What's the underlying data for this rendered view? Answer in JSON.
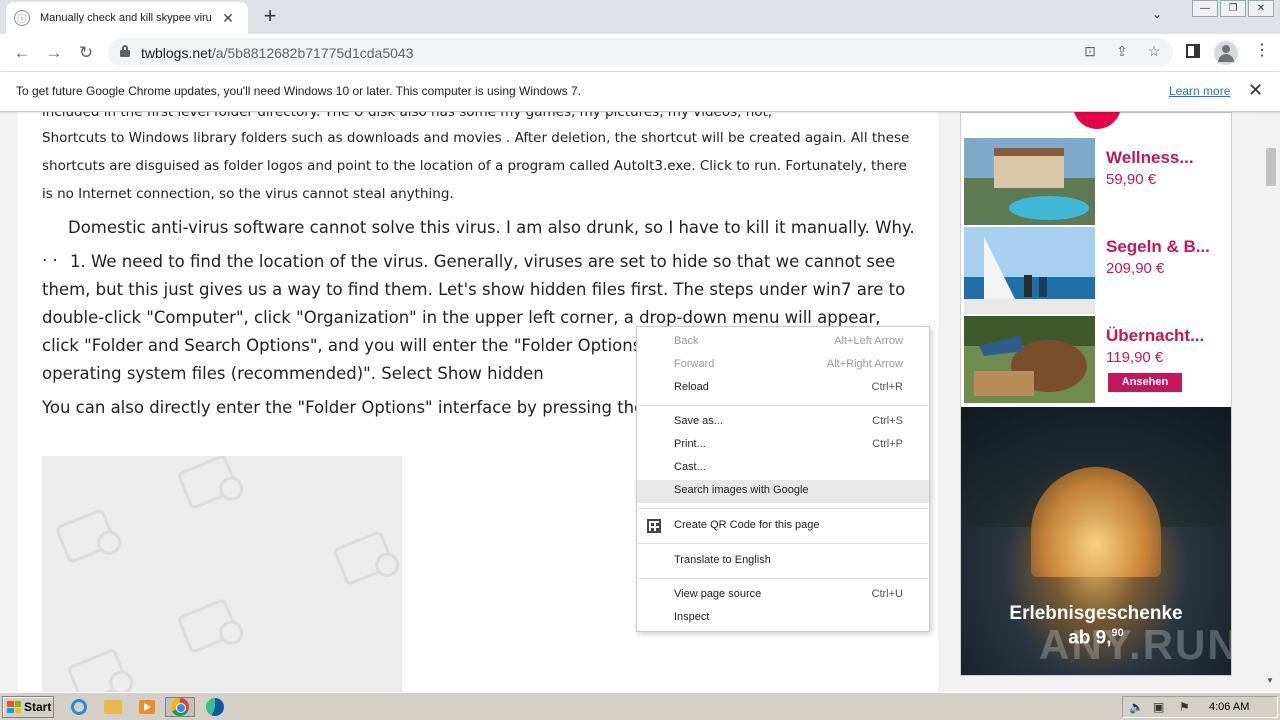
{
  "browser": {
    "tab": {
      "title": "Manually check and kill skypee virus",
      "favicon": "ⓘ",
      "close": "✕"
    },
    "new_tab": "+",
    "tab_search": "⌄",
    "window_controls": {
      "minimize": "—",
      "restore": "❐",
      "close": "✕"
    },
    "nav": {
      "back": "←",
      "forward": "→",
      "reload": "↻"
    },
    "url": {
      "host": "twblogs.net",
      "path": "/a/5b8812682b71775d1cda5043"
    },
    "omnibox_icons": {
      "translate": "⊡",
      "share": "⇪",
      "bookmark": "☆"
    },
    "menu": "⋮"
  },
  "infobar": {
    "message": "To get future Google Chrome updates, you'll need Windows 10 or later. This computer is using Windows 7.",
    "link": "Learn more",
    "close": "✕"
  },
  "article": {
    "p_cut": "included in the first level folder directory. The U disk also has some my games, my pictures, my videos, not,",
    "p1": "Shortcuts to Windows library folders such as downloads and movies . After deletion, the shortcut will be created again. All these shortcuts are disguised as folder logos and point to the location of a program called AutoIt3.exe. Click to run. Fortunately, there is no Internet connection, so the virus cannot steal anything.",
    "p2": "Domestic anti-virus software cannot solve this virus. I am also drunk, so I have to kill it manually. Why. . .",
    "p3": "1. We need to find the location of the virus. Generally, viruses are set to hide so that we cannot see them, but this just gives us a way to find them. Let's show hidden files first. The steps under win7 are to double-click \"Computer\", click \"Organization\" in the upper left corner, a drop-down menu will appear, click \"Folder and Search Options\", and you will enter the \"Folder Options\" interface. \"Hide protected operating system files (recommended)\". Select Show hidden",
    "p4": "You can also directly enter the \"Folder Options\" interface by pressing the entering control folders."
  },
  "ads": {
    "items": [
      {
        "title": "Wellness...",
        "price": "59,90 €"
      },
      {
        "title": "Segeln & B...",
        "price": "209,90 €"
      },
      {
        "title": "Übernacht...",
        "price": "119,90 €",
        "button": "Ansehen"
      }
    ],
    "banner": {
      "line1": "Erlebnisgeschenke",
      "line2": "ab 9,",
      "line2_sup": "90"
    },
    "watermark": "ANY.RUN"
  },
  "context_menu": {
    "items": [
      {
        "label": "Back",
        "shortcut": "Alt+Left Arrow",
        "disabled": true
      },
      {
        "label": "Forward",
        "shortcut": "Alt+Right Arrow",
        "disabled": true
      },
      {
        "label": "Reload",
        "shortcut": "Ctrl+R"
      },
      {
        "label": "Save as...",
        "shortcut": "Ctrl+S"
      },
      {
        "label": "Print...",
        "shortcut": "Ctrl+P"
      },
      {
        "label": "Cast..."
      },
      {
        "label": "Search images with Google",
        "hover": true
      },
      {
        "label": "Create QR Code for this page",
        "icon": "qr-code-icon"
      },
      {
        "label": "Translate to English"
      },
      {
        "label": "View page source",
        "shortcut": "Ctrl+U"
      },
      {
        "label": "Inspect"
      }
    ]
  },
  "taskbar": {
    "start": "Start",
    "clock": "4:06 AM",
    "tray_icons": {
      "volume": "🔈",
      "network": "▣",
      "flag": "⚑"
    }
  },
  "colors": {
    "accent_pink": "#c2185b",
    "link_blue": "#1a73e8",
    "tab_strip": "#dee1e6"
  }
}
